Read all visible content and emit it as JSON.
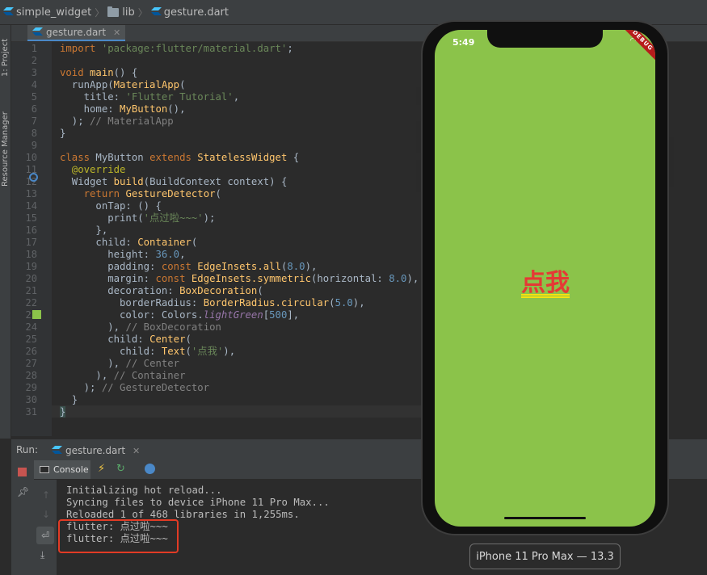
{
  "breadcrumb": {
    "project": "simple_widget",
    "folder": "lib",
    "file": "gesture.dart"
  },
  "left_strip": {
    "project_label": "1: Project",
    "resource_label": "Resource Manager"
  },
  "editor": {
    "tab_label": "gesture.dart",
    "line_numbers": [
      "1",
      "2",
      "3",
      "4",
      "5",
      "6",
      "7",
      "8",
      "9",
      "10",
      "11",
      "12",
      "13",
      "14",
      "15",
      "16",
      "17",
      "18",
      "19",
      "20",
      "21",
      "22",
      "23",
      "24",
      "25",
      "26",
      "27",
      "28",
      "29",
      "30",
      "31"
    ],
    "lines": {
      "l1": {
        "kw": "import",
        "str": "'package:flutter/material.dart'",
        "tail": ";"
      },
      "l3": {
        "kw": "void",
        "fn": "main",
        "tail": "() {"
      },
      "l4": {
        "pre": "  runApp(",
        "cls": "MaterialApp",
        "tail": "("
      },
      "l5": {
        "pre": "    title: ",
        "str": "'Flutter Tutorial'",
        "tail": ","
      },
      "l6": {
        "pre": "    home: ",
        "cls": "MyButton",
        "tail": "(),"
      },
      "l7": {
        "pre": "  );",
        "cmt": " // MaterialApp"
      },
      "l8": {
        "text": "}"
      },
      "l10": {
        "kw1": "class",
        "name": " MyButton ",
        "kw2": "extends",
        "cls": " StatelessWidget",
        "tail": " {"
      },
      "l11": {
        "ann": "  @override"
      },
      "l12": {
        "pre": "  Widget ",
        "fn": "build",
        "tail": "(BuildContext context) {"
      },
      "l13": {
        "kw": "    return",
        "cls": " GestureDetector",
        "tail": "("
      },
      "l14": {
        "text": "      onTap: () {"
      },
      "l15": {
        "pre": "        print(",
        "str": "'点过啦~~~'",
        "tail": ");"
      },
      "l16": {
        "text": "      },"
      },
      "l17": {
        "pre": "      child: ",
        "cls": "Container",
        "tail": "("
      },
      "l18": {
        "pre": "        height: ",
        "num": "36.0",
        "tail": ","
      },
      "l19": {
        "pre": "        padding: ",
        "kw": "const",
        "cls": " EdgeInsets.all",
        "tail": "(",
        "num": "8.0",
        "end": "),"
      },
      "l20": {
        "pre": "        margin: ",
        "kw": "const",
        "cls": " EdgeInsets.symmetric",
        "tail": "(horizontal: ",
        "num": "8.0",
        "end": "),"
      },
      "l21": {
        "pre": "        decoration: ",
        "cls": "BoxDecoration",
        "tail": "("
      },
      "l22": {
        "pre": "          borderRadius: ",
        "cls": "BorderRadius.circular",
        "tail": "(",
        "num": "5.0",
        "end": "),"
      },
      "l23": {
        "pre": "          color: Colors.",
        "ital": "lightGreen",
        "tail": "[",
        "num": "500",
        "end": "],"
      },
      "l24": {
        "pre": "        ),",
        "cmt": " // BoxDecoration"
      },
      "l25": {
        "pre": "        child: ",
        "cls": "Center",
        "tail": "("
      },
      "l26": {
        "pre": "          child: ",
        "cls": "Text",
        "tail": "(",
        "str": "'点我'",
        "end": "),"
      },
      "l27": {
        "pre": "        ),",
        "cmt": " // Center"
      },
      "l28": {
        "pre": "      ),",
        "cmt": " // Container"
      },
      "l29": {
        "pre": "    );",
        "cmt": " // GestureDetector"
      },
      "l30": {
        "text": "  }"
      },
      "l31": {
        "text": "}"
      }
    }
  },
  "run_panel": {
    "run_label": "Run:",
    "tab_label": "gesture.dart",
    "console_tab": "Console",
    "output": [
      "Initializing hot reload...",
      "Syncing files to device iPhone 11 Pro Max...",
      "Reloaded 1 of 468 libraries in 1,255ms.",
      "flutter: 点过啦~~~",
      "flutter: 点过啦~~~"
    ]
  },
  "device": {
    "status_time": "5:49",
    "debug_banner": "DEBUG",
    "button_text": "点我",
    "device_name": "iPhone 11 Pro Max — 13.3",
    "screen_color": "#8bc34a",
    "text_color": "#e53935",
    "underline_color": "#f5e30f"
  },
  "colors": {
    "highlight_box": "#e23b25",
    "gutter_marker": "#8bc34a"
  }
}
